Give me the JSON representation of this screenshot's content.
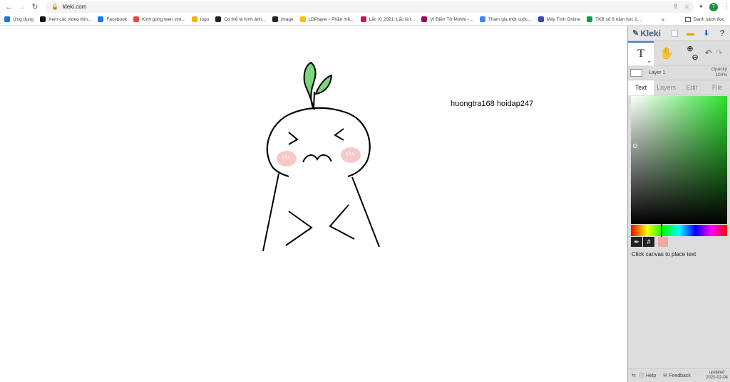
{
  "browser": {
    "url": "kleki.com",
    "avatar_letter": "T",
    "bookmarks": [
      {
        "label": "Ứng dụng",
        "color": "#1a73e8"
      },
      {
        "label": "Xem các video thin...",
        "color": "#111111"
      },
      {
        "label": "Facebook",
        "color": "#1877f2"
      },
      {
        "label": "Kinh gong teen vint...",
        "color": "#e74c3c"
      },
      {
        "label": "logo",
        "color": "#f4b400"
      },
      {
        "label": "Có thể là hình ảnh...",
        "color": "#222222"
      },
      {
        "label": "image",
        "color": "#222222"
      },
      {
        "label": "LDPlayer - Phần mề...",
        "color": "#f4c20d"
      },
      {
        "label": "Lắc Xì 2021: Lắc là t...",
        "color": "#c2185b"
      },
      {
        "label": "Ví Điện Tử MoMo -...",
        "color": "#a50064"
      },
      {
        "label": "Tham gia một cuộc...",
        "color": "#4285f4"
      },
      {
        "label": "Máy Tính Online",
        "color": "#3949ab"
      },
      {
        "label": "TKB số 8 năm học 2...",
        "color": "#0f9d58"
      }
    ],
    "more_label": "»",
    "reading_list": "Danh sách đọc"
  },
  "canvas": {
    "text": "huongtra168 hoidap247"
  },
  "panel": {
    "logo": "Kleki",
    "layer_name": "Layer 1",
    "opacity_label": "Opacity",
    "opacity_value": "100%",
    "tabs": [
      "Text",
      "Layers",
      "Edit",
      "File"
    ],
    "text_tool_label": "T",
    "hint": "Click canvas to place text",
    "help": "Help",
    "feedback": "Feedback",
    "updated_label": "updated",
    "updated_date": "2022-02-04",
    "current_color": "#f0a8a8",
    "hex_label": "#"
  }
}
